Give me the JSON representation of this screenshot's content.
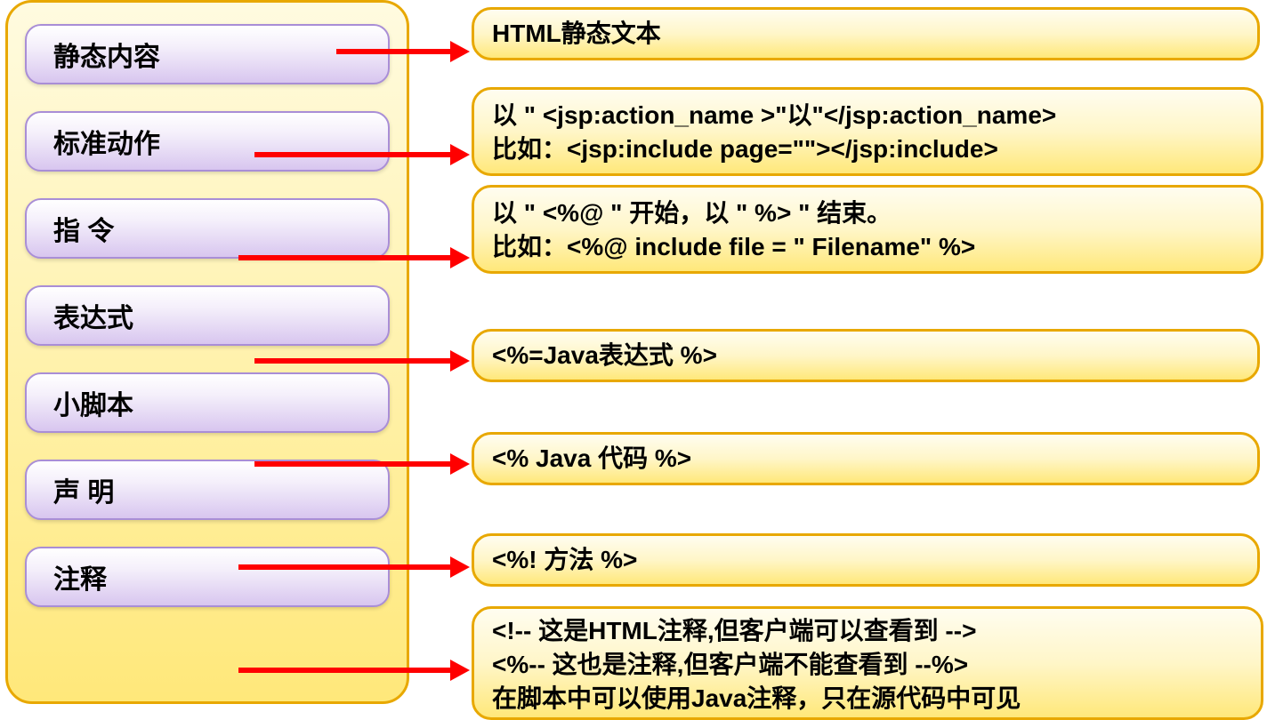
{
  "left": {
    "items": [
      "静态内容",
      "标准动作",
      "指 令",
      "表达式",
      "小脚本",
      "声 明",
      "注释"
    ]
  },
  "right": {
    "box0": "HTML静态文本",
    "box1_line1": "以 \" <jsp:action_name >\"以\"</jsp:action_name>",
    "box1_line2": "比如：<jsp:include page=\"\"></jsp:include>",
    "box2_line1": "以 \" <%@ \" 开始，以 \" %> \" 结束。",
    "box2_line2": "比如：<%@ include file = \" Filename\" %>",
    "box3": "<%=Java表达式 %>",
    "box4": "<% Java 代码 %>",
    "box5": "<%! 方法 %>",
    "box6_line1": "<!-- 这是HTML注释,但客户端可以查看到 -->",
    "box6_line2": "<%-- 这也是注释,但客户端不能查看到 --%>",
    "box6_line3": "在脚本中可以使用Java注释，只在源代码中可见"
  }
}
